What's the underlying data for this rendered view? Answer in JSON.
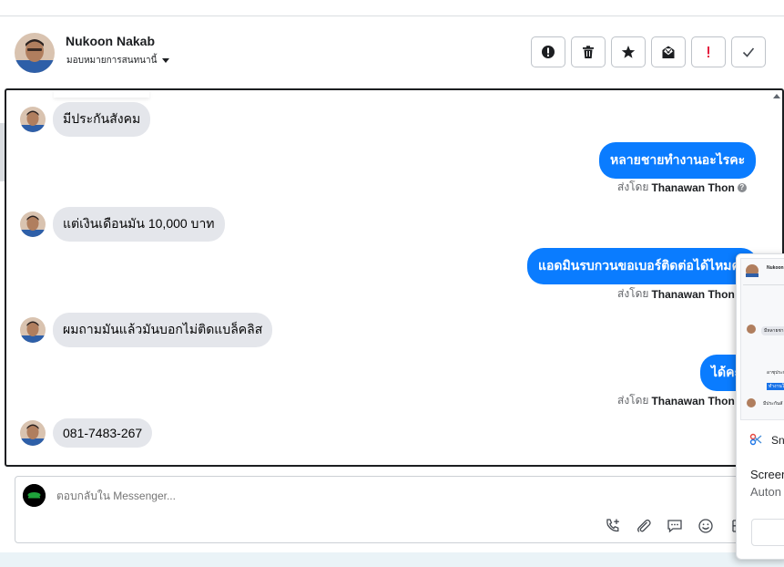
{
  "header": {
    "name": "Nukoon Nakab",
    "assign_label": "มอบหมายการสนทนานี้",
    "actions": [
      {
        "name": "report-spam-button",
        "icon": "exclamation-circle-icon"
      },
      {
        "name": "delete-button",
        "icon": "trash-icon"
      },
      {
        "name": "star-button",
        "icon": "star-icon"
      },
      {
        "name": "mark-unread-button",
        "icon": "mail-open-icon"
      },
      {
        "name": "mark-important-button",
        "icon": "exclamation-icon"
      },
      {
        "name": "mark-done-button",
        "icon": "check-icon"
      }
    ]
  },
  "messages": [
    {
      "dir": "in",
      "text": "มีประกันสังคม"
    },
    {
      "dir": "out",
      "text": "หลายชายทำงานอะไรคะ",
      "sent_by_prefix": "ส่งโดย",
      "sent_by": "Thanawan Thon"
    },
    {
      "dir": "in",
      "text": "แต่เงินเดือนมัน 10,000 บาท"
    },
    {
      "dir": "out",
      "text": "แอดมินรบกวนขอเบอร์ติดต่อได้ไหมคะ",
      "sent_by_prefix": "ส่งโดย",
      "sent_by": "Thanawan Thon"
    },
    {
      "dir": "in",
      "text": "ผมถามมันแล้วมันบอกไม่ติดแบล็คลิส"
    },
    {
      "dir": "out",
      "text": "ได้คะ",
      "sent_by_prefix": "ส่งโดย",
      "sent_by": "Thanawan Thon"
    },
    {
      "dir": "in",
      "text": "081-7483-267"
    }
  ],
  "composer": {
    "placeholder": "ตอบกลับใน Messenger...",
    "tools": [
      "add-call-icon",
      "paperclip-icon",
      "saved-reply-icon",
      "emoji-icon",
      "baht-icon"
    ]
  },
  "popup": {
    "thumb_name": "Nukoon",
    "thumb_line1": "มีหลายชาย",
    "thumb_line2": "อาชุประกัน",
    "thumb_line3": "ทำงานใน",
    "thumb_line4": "มีประกันสั",
    "app_label": "Sn",
    "title": "Screen",
    "subtitle": "Auton"
  },
  "colors": {
    "outgoing_bubble": "#0a7cff",
    "incoming_bubble": "#e4e6eb",
    "important": "#e41e3f"
  }
}
